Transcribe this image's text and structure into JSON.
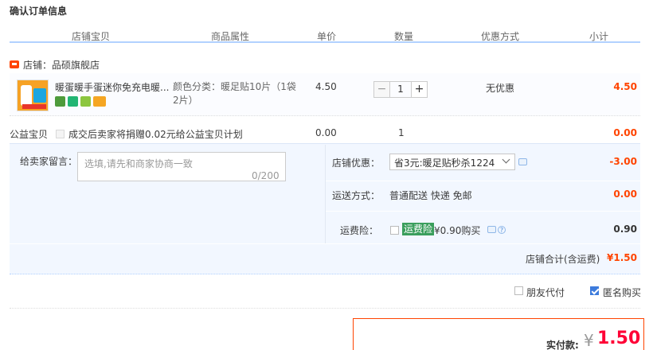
{
  "page_title": "确认订单信息",
  "columns": [
    "店铺宝贝",
    "商品属性",
    "单价",
    "数量",
    "优惠方式",
    "小计"
  ],
  "shop": {
    "label": "店铺：品硕旗舰店"
  },
  "item": {
    "name": "暖蛋暖手蛋迷你免充电暖...",
    "sku": "颜色分类：暖足贴10片（1袋2片）",
    "price": "4.50",
    "quantity": "1",
    "quantity_minus": "−",
    "quantity_plus": "+",
    "promo": "无优惠",
    "subtotal": "4.50"
  },
  "charity": {
    "label": "公益宝贝",
    "text": "成交后卖家将捐赠0.02元给公益宝贝计划",
    "price": "0.00",
    "quantity": "1",
    "subtotal": "0.00"
  },
  "memo": {
    "label": "给卖家留言：",
    "placeholder": "选填,请先和商家协商一致",
    "counter": "0/200"
  },
  "shop_discount": {
    "label": "店铺优惠：",
    "selected": "省3元:暖足贴秒杀1224",
    "value": "-3.00"
  },
  "shipping": {
    "label": "运送方式：",
    "text": "普通配送 快递 免邮",
    "value": "0.00"
  },
  "insurance": {
    "label": "运费险：",
    "tag": "运费险",
    "price": "¥0.90购买",
    "value": "0.90"
  },
  "shop_total": {
    "label": "店铺合计(含运费)",
    "value": "¥1.50"
  },
  "options": {
    "friend_pay": "朋友代付",
    "anonymous": "匿名购买",
    "anonymous_checked": true,
    "friend_checked": false
  },
  "payment": {
    "label": "实付款:",
    "currency": "¥",
    "value": "1.50"
  },
  "colors": {
    "accent": "#ff4400",
    "price_red": "#ff0036",
    "header_line": "#b2d1ff",
    "panel_bg": "#f2f7ff"
  }
}
